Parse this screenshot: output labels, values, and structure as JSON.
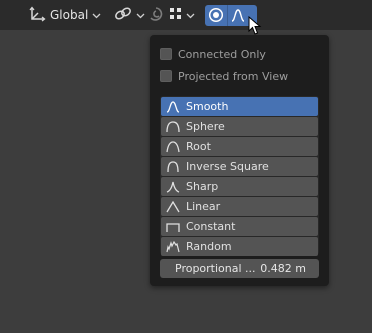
{
  "toolbar": {
    "orientation": {
      "label": "Global",
      "icon": "transform-orientation-icon"
    },
    "snap": {
      "icon": "snap-link-icon"
    },
    "proportional_connected_icon": "proportional-connected-icon",
    "snap_increment_icon": "snap-increment-grid-icon",
    "proportional_edit_icon": "proportional-edit-toggle-icon",
    "falloff_icon": "falloff-smooth-icon",
    "active_color": "#4772b3"
  },
  "popup": {
    "options": [
      {
        "label": "Connected Only",
        "checked": false
      },
      {
        "label": "Projected from View",
        "checked": false
      }
    ],
    "falloff_items": [
      {
        "label": "Smooth",
        "icon": "smooth-curve-icon",
        "selected": true
      },
      {
        "label": "Sphere",
        "icon": "sphere-curve-icon",
        "selected": false
      },
      {
        "label": "Root",
        "icon": "root-curve-icon",
        "selected": false
      },
      {
        "label": "Inverse Square",
        "icon": "inverse-square-curve-icon",
        "selected": false
      },
      {
        "label": "Sharp",
        "icon": "sharp-curve-icon",
        "selected": false
      },
      {
        "label": "Linear",
        "icon": "linear-curve-icon",
        "selected": false
      },
      {
        "label": "Constant",
        "icon": "constant-curve-icon",
        "selected": false
      },
      {
        "label": "Random",
        "icon": "random-curve-icon",
        "selected": false
      }
    ],
    "proportional_size": {
      "label": "Proportional ...",
      "value": "0.482 m"
    }
  }
}
